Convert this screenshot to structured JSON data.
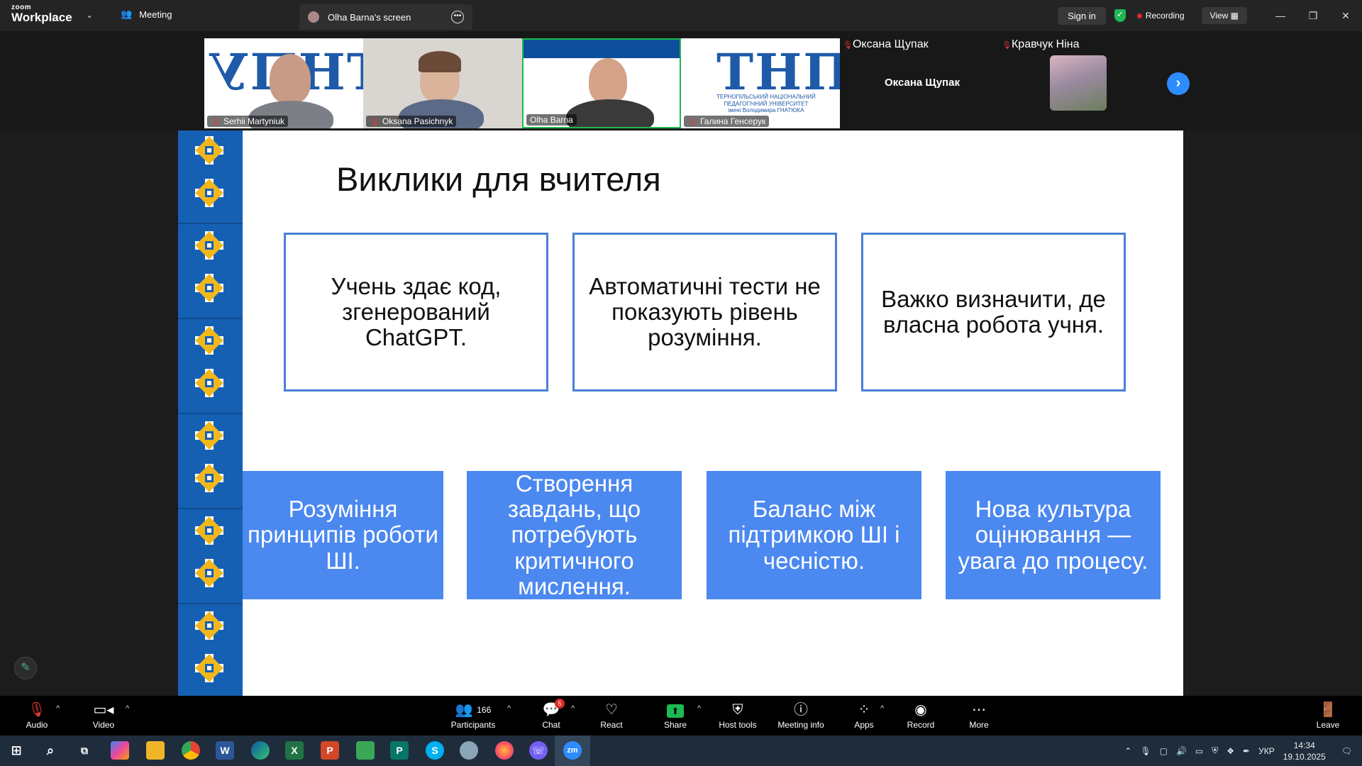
{
  "app": {
    "logo_small": "zoom",
    "logo_big": "Workplace",
    "meeting_label": "Meeting",
    "screen_tab": "Olha Barna's screen",
    "sign_in": "Sign in",
    "recording": "Recording",
    "view": "View"
  },
  "participants": [
    {
      "name": "Serhii Martyniuk"
    },
    {
      "name": "Oksana Pasichnyk"
    },
    {
      "name": "Olha Barna"
    },
    {
      "name": "Галина Генсерук"
    },
    {
      "name": "Оксана Щупак"
    },
    {
      "name": "Кравчук Ніна"
    }
  ],
  "tile_logo": {
    "letters": "ТНПУ",
    "text_line1": "ТЕРНОПІЛЬСЬКИЙ НАЦІОНАЛЬНИЙ",
    "text_line2": "ПЕДАГОГІЧНИЙ УНІВЕРСИТЕТ",
    "text_line3": "імені Володимира ГНАТЮКА"
  },
  "slide": {
    "title": "Виклики для вчителя",
    "boxes": [
      "Учень здає код, згенерований ChatGPT.",
      "Автоматичні тести не показують рівень розуміння.",
      "Важко визначити, де власна робота учня."
    ],
    "cards": [
      "Розуміння принципів роботи ШІ.",
      "Створення завдань, що потребують критичного мислення.",
      "Баланс між підтримкою ШІ і чесністю.",
      "Нова культура оцінювання — увага до процесу."
    ],
    "colors": {
      "ornament": "#1660b4",
      "gold": "#f2b71c",
      "card": "#4b88f0",
      "border": "#4a7fd6"
    }
  },
  "controls": {
    "audio": "Audio",
    "video": "Video",
    "participants": "Participants",
    "participants_count": "166",
    "chat": "Chat",
    "chat_badge": "5",
    "react": "React",
    "share": "Share",
    "host_tools": "Host tools",
    "meeting_info": "Meeting info",
    "apps": "Apps",
    "record": "Record",
    "more": "More",
    "leave": "Leave"
  },
  "taskbar": {
    "language": "УКР",
    "time": "14:34",
    "date": "19.10.2025"
  }
}
